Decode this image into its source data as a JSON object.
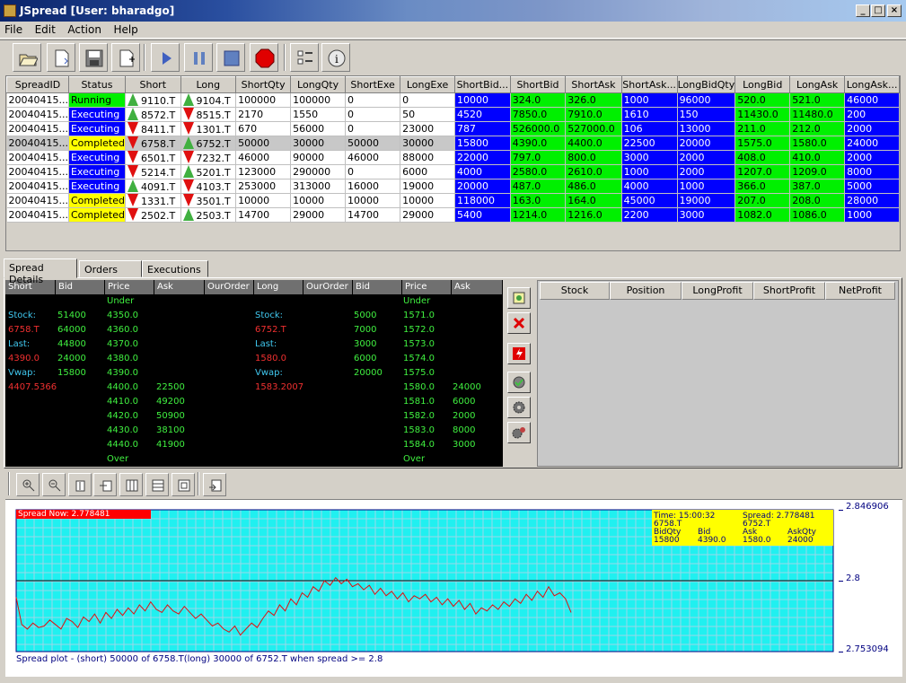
{
  "window": {
    "title": "JSpread [User: bharadgo]"
  },
  "menu": [
    "File",
    "Edit",
    "Action",
    "Help"
  ],
  "toolbar": {
    "buttons": [
      "open-icon",
      "new-icon",
      "save-icon",
      "new-document-icon",
      "play-icon",
      "pause-icon",
      "stop-icon",
      "stop-sign-icon",
      "checklist-icon",
      "info-icon"
    ]
  },
  "spreads": {
    "columns": [
      "SpreadID",
      "Status",
      "Short",
      "Long",
      "ShortQty",
      "LongQty",
      "ShortExe",
      "LongExe",
      "ShortBid...",
      "ShortBid",
      "ShortAsk",
      "ShortAsk...",
      "LongBidQty",
      "LongBid",
      "LongAsk",
      "LongAsk..."
    ],
    "rows": [
      {
        "id": "20040415...",
        "status": "Running",
        "short": "9110.T",
        "short_dir": "up",
        "long": "9104.T",
        "long_dir": "up",
        "shortQty": "100000",
        "longQty": "100000",
        "shortExe": "0",
        "longExe": "0",
        "sbq": "10000",
        "sb": "324.0",
        "sa": "326.0",
        "saq": "1000",
        "lbq": "96000",
        "lb": "520.0",
        "la": "521.0",
        "laq": "46000"
      },
      {
        "id": "20040415...",
        "status": "Executing",
        "short": "8572.T",
        "short_dir": "up",
        "long": "8515.T",
        "long_dir": "down",
        "shortQty": "2170",
        "longQty": "1550",
        "shortExe": "0",
        "longExe": "50",
        "sbq": "4520",
        "sb": "7850.0",
        "sa": "7910.0",
        "saq": "1610",
        "lbq": "150",
        "lb": "11430.0",
        "la": "11480.0",
        "laq": "200"
      },
      {
        "id": "20040415...",
        "status": "Executing",
        "short": "8411.T",
        "short_dir": "down",
        "long": "1301.T",
        "long_dir": "down",
        "shortQty": "670",
        "longQty": "56000",
        "shortExe": "0",
        "longExe": "23000",
        "sbq": "787",
        "sb": "526000.0",
        "sa": "527000.0",
        "saq": "106",
        "lbq": "13000",
        "lb": "211.0",
        "la": "212.0",
        "laq": "2000"
      },
      {
        "id": "20040415...",
        "status": "Completed",
        "short": "6758.T",
        "short_dir": "down",
        "long": "6752.T",
        "long_dir": "up",
        "shortQty": "50000",
        "longQty": "30000",
        "shortExe": "50000",
        "longExe": "30000",
        "sbq": "15800",
        "sb": "4390.0",
        "sa": "4400.0",
        "saq": "22500",
        "lbq": "20000",
        "lb": "1575.0",
        "la": "1580.0",
        "laq": "24000",
        "selected": true
      },
      {
        "id": "20040415...",
        "status": "Executing",
        "short": "6501.T",
        "short_dir": "down",
        "long": "7232.T",
        "long_dir": "down",
        "shortQty": "46000",
        "longQty": "90000",
        "shortExe": "46000",
        "longExe": "88000",
        "sbq": "22000",
        "sb": "797.0",
        "sa": "800.0",
        "saq": "3000",
        "lbq": "2000",
        "lb": "408.0",
        "la": "410.0",
        "laq": "2000"
      },
      {
        "id": "20040415...",
        "status": "Executing",
        "short": "5214.T",
        "short_dir": "down",
        "long": "5201.T",
        "long_dir": "up",
        "shortQty": "123000",
        "longQty": "290000",
        "shortExe": "0",
        "longExe": "6000",
        "sbq": "4000",
        "sb": "2580.0",
        "sa": "2610.0",
        "saq": "1000",
        "lbq": "2000",
        "lb": "1207.0",
        "la": "1209.0",
        "laq": "8000"
      },
      {
        "id": "20040415...",
        "status": "Executing",
        "short": "4091.T",
        "short_dir": "up",
        "long": "4103.T",
        "long_dir": "down",
        "shortQty": "253000",
        "longQty": "313000",
        "shortExe": "16000",
        "longExe": "19000",
        "sbq": "20000",
        "sb": "487.0",
        "sa": "486.0",
        "saq": "4000",
        "lbq": "1000",
        "lb": "366.0",
        "la": "387.0",
        "laq": "5000"
      },
      {
        "id": "20040415...",
        "status": "Completed",
        "short": "1331.T",
        "short_dir": "down",
        "long": "3501.T",
        "long_dir": "down",
        "shortQty": "10000",
        "longQty": "10000",
        "shortExe": "10000",
        "longExe": "10000",
        "sbq": "118000",
        "sb": "163.0",
        "sa": "164.0",
        "saq": "45000",
        "lbq": "19000",
        "lb": "207.0",
        "la": "208.0",
        "laq": "28000"
      },
      {
        "id": "20040415...",
        "status": "Completed",
        "short": "2502.T",
        "short_dir": "down",
        "long": "2503.T",
        "long_dir": "up",
        "shortQty": "14700",
        "longQty": "29000",
        "shortExe": "14700",
        "longExe": "29000",
        "sbq": "5400",
        "sb": "1214.0",
        "sa": "1216.0",
        "saq": "2200",
        "lbq": "3000",
        "lb": "1082.0",
        "la": "1086.0",
        "laq": "1000"
      }
    ]
  },
  "tabs": [
    "Spread Details",
    "Orders",
    "Executions"
  ],
  "book": {
    "headers": [
      "Short",
      "Bid",
      "Price",
      "Ask",
      "OurOrder",
      "Long",
      "OurOrder",
      "Bid",
      "Price",
      "Ask"
    ],
    "short_info": [
      [
        "Stock:",
        "51400"
      ],
      [
        "6758.T",
        "64000"
      ],
      [
        "Last:",
        "44800"
      ],
      [
        "4390.0",
        "24000"
      ],
      [
        "Vwap:",
        "15800"
      ],
      [
        "4407.5366",
        ""
      ]
    ],
    "short_prices": [
      "Under",
      "4350.0",
      "4360.0",
      "4370.0",
      "4380.0",
      "4390.0",
      "4400.0",
      "4410.0",
      "4420.0",
      "4430.0",
      "4440.0",
      "Over"
    ],
    "short_asks": [
      "",
      "",
      "",
      "",
      "",
      "",
      "22500",
      "49200",
      "50900",
      "38100",
      "41900",
      ""
    ],
    "long_info": [
      [
        "Stock:",
        "5000"
      ],
      [
        "6752.T",
        "7000"
      ],
      [
        "Last:",
        "3000"
      ],
      [
        "1580.0",
        "6000"
      ],
      [
        "Vwap:",
        "20000"
      ],
      [
        "1583.2007",
        ""
      ]
    ],
    "long_prices": [
      "Under",
      "1571.0",
      "1572.0",
      "1573.0",
      "1574.0",
      "1575.0",
      "1580.0",
      "1581.0",
      "1582.0",
      "1583.0",
      "1584.0",
      "Over"
    ],
    "long_asks": [
      "",
      "",
      "",
      "",
      "",
      "",
      "24000",
      "6000",
      "2000",
      "8000",
      "3000",
      ""
    ]
  },
  "profit_columns": [
    "Stock",
    "Position",
    "LongProfit",
    "ShortProfit",
    "NetProfit"
  ],
  "chart": {
    "spread_now": "Spread Now: 2.778481",
    "info": {
      "time": "Time: 15:00:32",
      "spread": "Spread: 2.778481",
      "short": "6758.T",
      "long": "6752.T",
      "h1": "BidQty",
      "h2": "Bid",
      "h3": "Ask",
      "h4": "AskQty",
      "v1": "15800",
      "v2": "4390.0",
      "v3": "1580.0",
      "v4": "24000"
    },
    "footnote": "Spread plot - (short) 50000 of 6758.T(long) 30000 of 6752.T when spread >= 2.8"
  },
  "chart_data": {
    "type": "line",
    "ylim": [
      2.753094,
      2.846906
    ],
    "y_ticks": [
      "2.846906",
      "2.8",
      "2.753094"
    ],
    "threshold": 2.8,
    "series": [
      {
        "values": [
          2.789,
          2.771,
          2.768,
          2.772,
          2.769,
          2.77,
          2.774,
          2.771,
          2.768,
          2.775,
          2.773,
          2.769,
          2.776,
          2.773,
          2.778,
          2.772,
          2.779,
          2.775,
          2.781,
          2.777,
          2.782,
          2.778,
          2.784,
          2.78,
          2.786,
          2.781,
          2.779,
          2.784,
          2.78,
          2.778,
          2.783,
          2.779,
          2.775,
          2.778,
          2.774,
          2.77,
          2.772,
          2.768,
          2.766,
          2.77,
          2.764,
          2.768,
          2.772,
          2.769,
          2.775,
          2.78,
          2.777,
          2.784,
          2.78,
          2.788,
          2.784,
          2.792,
          2.789,
          2.796,
          2.793,
          2.8,
          2.797,
          2.802,
          2.798,
          2.801,
          2.796,
          2.798,
          2.794,
          2.797,
          2.791,
          2.795,
          2.79,
          2.793,
          2.788,
          2.792,
          2.786,
          2.79,
          2.788,
          2.791,
          2.786,
          2.789,
          2.784,
          2.788,
          2.783,
          2.787,
          2.781,
          2.785,
          2.778,
          2.782,
          2.78,
          2.784,
          2.781,
          2.786,
          2.783,
          2.788,
          2.785,
          2.791,
          2.787,
          2.793,
          2.789,
          2.796,
          2.79,
          2.792,
          2.788,
          2.779
        ]
      }
    ]
  },
  "colors": {
    "chart_bg": "#20f0f0",
    "grid": "#9ad8e8",
    "line": "#e01010",
    "threshold": "#000000"
  }
}
